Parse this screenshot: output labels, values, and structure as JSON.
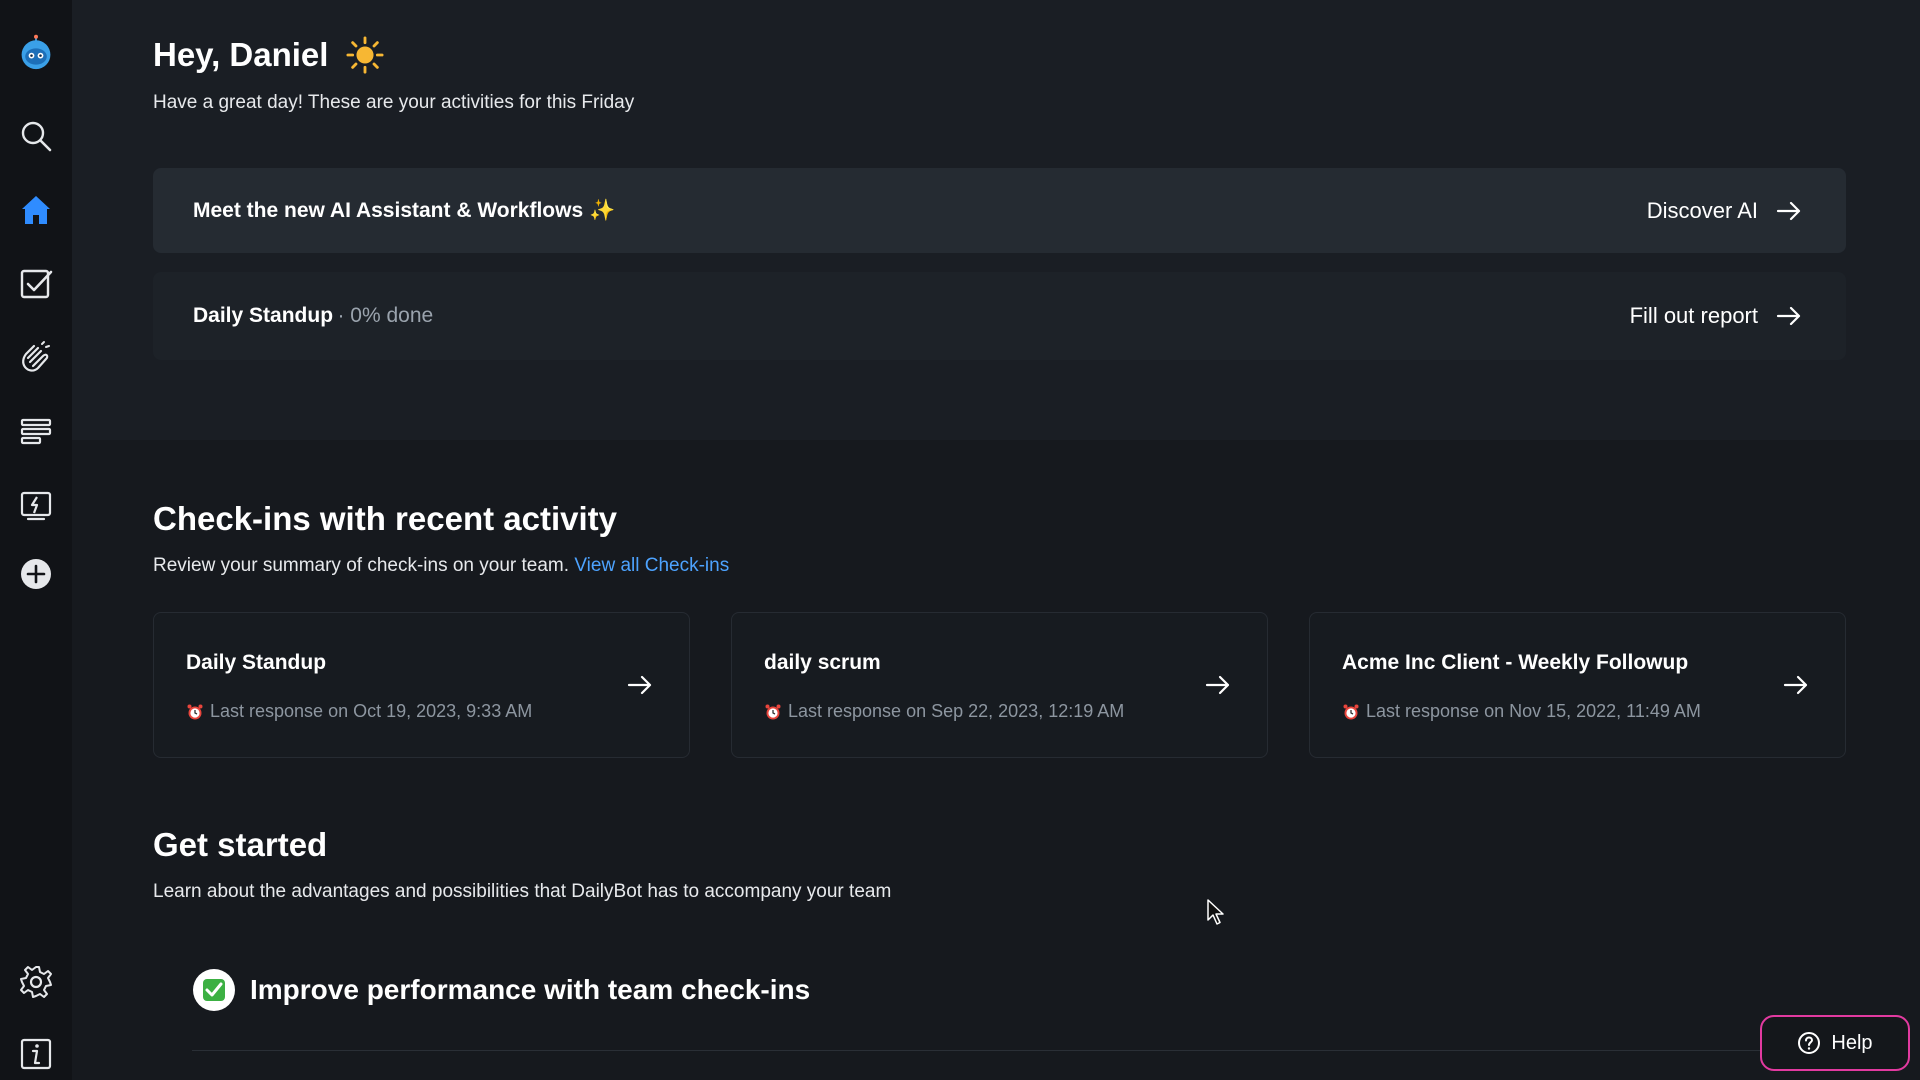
{
  "sidebar": {
    "items": [
      {
        "name": "logo",
        "icon": "robot-logo-icon"
      },
      {
        "name": "search",
        "icon": "search-icon"
      },
      {
        "name": "home",
        "icon": "home-icon",
        "active": true
      },
      {
        "name": "checkins",
        "icon": "checkbox-icon"
      },
      {
        "name": "kudos",
        "icon": "clapping-hands-icon"
      },
      {
        "name": "forms",
        "icon": "list-lines-icon"
      },
      {
        "name": "workflows",
        "icon": "lightning-screen-icon"
      },
      {
        "name": "add",
        "icon": "plus-circle-icon"
      },
      {
        "name": "settings",
        "icon": "gear-icon"
      },
      {
        "name": "info",
        "icon": "info-icon"
      }
    ],
    "accent": "#2f8cff"
  },
  "header": {
    "greeting": "Hey, Daniel",
    "subtitle": "Have a great day! These are your activities for this Friday"
  },
  "banner": {
    "title": "Meet the new AI Assistant & Workflows",
    "sparkle": "✨",
    "action": "Discover AI"
  },
  "standup": {
    "title": "Daily Standup",
    "progress": "· 0% done",
    "action": "Fill out report"
  },
  "checkins": {
    "title": "Check-ins with recent activity",
    "subtitle": "Review your summary of check-ins on your team.",
    "link": "View all Check-ins",
    "cards": [
      {
        "title": "Daily Standup",
        "meta": "Last response on Oct 19, 2023, 9:33 AM"
      },
      {
        "title": "daily scrum",
        "meta": "Last response on Sep 22, 2023, 12:19 AM"
      },
      {
        "title": "Acme Inc Client - Weekly Followup",
        "meta": "Last response on Nov 15, 2022, 11:49 AM"
      }
    ]
  },
  "get_started": {
    "title": "Get started",
    "subtitle": "Learn about the advantages and possibilities that DailyBot has to accompany your team",
    "steps": [
      {
        "label": "Improve performance with team check-ins",
        "done": true
      }
    ]
  },
  "help": {
    "label": "Help"
  }
}
